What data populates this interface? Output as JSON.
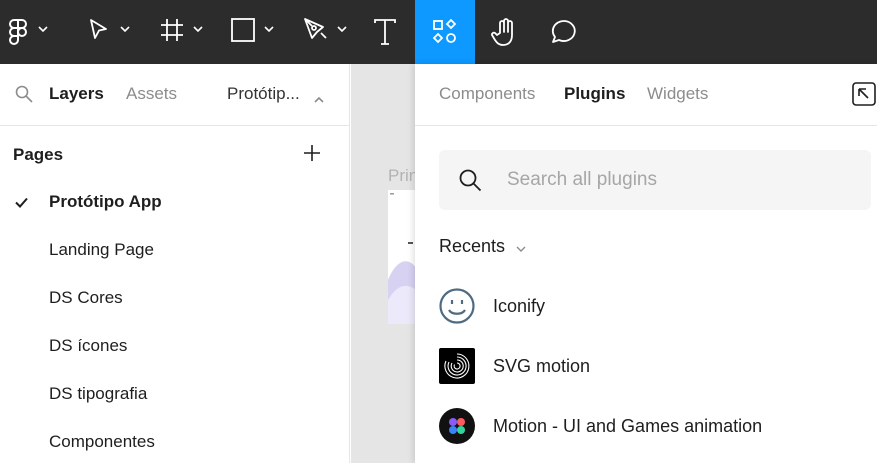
{
  "toolbar": {
    "tools": [
      {
        "name": "main-menu"
      },
      {
        "name": "move-tool"
      },
      {
        "name": "frame-tool"
      },
      {
        "name": "shape-tool"
      },
      {
        "name": "pen-tool"
      },
      {
        "name": "text-tool"
      },
      {
        "name": "resources-tool",
        "active": true
      },
      {
        "name": "hand-tool"
      },
      {
        "name": "comment-tool"
      }
    ],
    "accent": "#0d99ff",
    "background": "#2c2c2c"
  },
  "left_panel": {
    "tabs": {
      "layers": "Layers",
      "assets": "Assets",
      "page_switch": "Protótip..."
    },
    "pages_title": "Pages",
    "pages": [
      "Protótipo App",
      "Landing Page",
      "DS Cores",
      "DS ícones",
      "DS tipografia",
      "Componentes"
    ],
    "current_page": "Protótipo App"
  },
  "canvas": {
    "frame_title": "Prin"
  },
  "resources_panel": {
    "tabs": [
      "Components",
      "Plugins",
      "Widgets"
    ],
    "selected_tab": "Plugins",
    "search_placeholder": "Search all plugins",
    "recents_label": "Recents",
    "plugins": [
      "Iconify",
      "SVG motion",
      "Motion - UI and Games animation"
    ]
  }
}
